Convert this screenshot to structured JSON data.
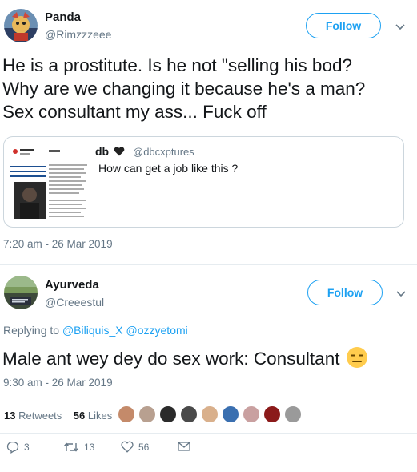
{
  "tweet1": {
    "name": "Panda",
    "handle": "@Rimzzzeee",
    "follow_label": "Follow",
    "text_line1": "He is a prostitute. Is he not \"selling his bod?",
    "text_line2": "Why are we changing it because he's a man?",
    "text_line3": "Sex consultant my ass... Fuck off",
    "timestamp": "7:20 am - 26 Mar 2019",
    "quote": {
      "name": "db",
      "handle": "@dbcxptures",
      "text": "How can get a job like this ?"
    }
  },
  "tweet2": {
    "name": "Ayurveda",
    "handle": "@Creeestul",
    "follow_label": "Follow",
    "replying_prefix": "Replying to ",
    "replying_to_1": "@Biliquis_X",
    "replying_to_2": "@ozzyetomi",
    "text": "Male ant wey dey do sex work: Consultant",
    "timestamp": "9:30 am - 26 Mar 2019",
    "retweets_count": "13",
    "retweets_label": "Retweets",
    "likes_count": "56",
    "likes_label": "Likes",
    "actions": {
      "reply_count": "3",
      "retweet_count": "13",
      "like_count": "56"
    }
  },
  "colors": {
    "accent": "#1da1f2",
    "secondary_text": "#657786",
    "border": "#e6ecf0"
  }
}
